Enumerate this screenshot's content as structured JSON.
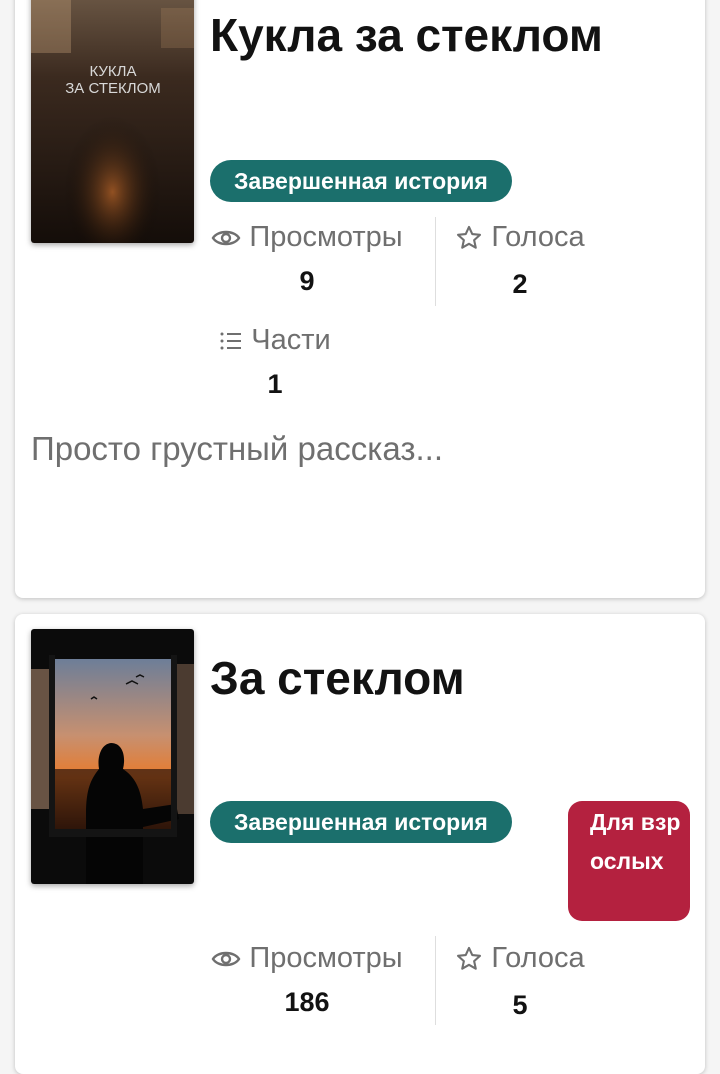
{
  "stories": [
    {
      "title": "Кукла за стеклом",
      "cover_text": "КУКЛА\nЗА СТЕКЛОМ",
      "status_badge": "Завершенная история",
      "stats": {
        "views_label": "Просмотры",
        "views_value": "9",
        "votes_label": "Голоса",
        "votes_value": "2",
        "parts_label": "Части",
        "parts_value": "1"
      },
      "description": "Просто грустный рассказ..."
    },
    {
      "title": "За стеклом",
      "status_badge": "Завершенная история",
      "mature_badge": "Для взрослых",
      "stats": {
        "views_label": "Просмотры",
        "views_value": "186",
        "votes_label": "Голоса",
        "votes_value": "5"
      }
    }
  ],
  "colors": {
    "completed_badge": "#1b6f6c",
    "mature_badge": "#b4213f",
    "muted_text": "#6f6f6f"
  },
  "icons": [
    "eye-icon",
    "star-icon",
    "list-icon"
  ]
}
